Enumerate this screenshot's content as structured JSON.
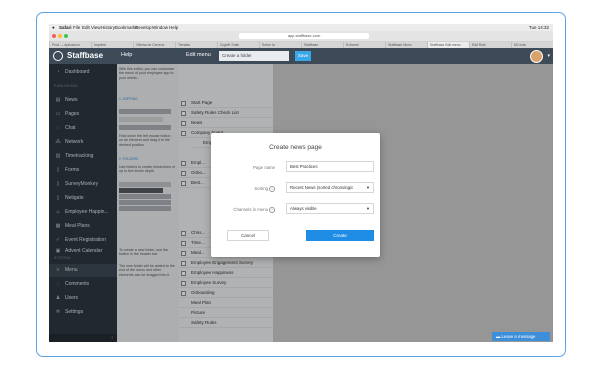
{
  "menubar": {
    "items": [
      "Safari",
      "File",
      "Edit",
      "View",
      "History",
      "Bookmarks",
      "Develop",
      "Window",
      "Help"
    ],
    "time": "Tue 14:32"
  },
  "browser": {
    "url": "app.staffbase.com",
    "tabs": [
      "Prod — Aplicacion",
      "Imprimir",
      "Oficina de Correos",
      "Tiendas",
      "Zugriff: Suite",
      "Sobre la",
      "Staffbase",
      "Extranet",
      "Staffbase Mono",
      "Staffbase Edit menu",
      "Edit Role",
      "Mi Lista"
    ]
  },
  "app": {
    "brand": "Staffbase",
    "help_title": "Help",
    "edit_menu_title": "Edit menu",
    "folder_select_placeholder": "Create a folder",
    "save_label": "Save"
  },
  "sidebar": {
    "section_publish": "PUBLISHING",
    "section_system": "SYSTEM",
    "items": [
      {
        "label": "Dashboard",
        "icon": "dashboard-icon"
      },
      {
        "label": "News",
        "icon": "news-icon"
      },
      {
        "label": "Pages",
        "icon": "pages-icon"
      },
      {
        "label": "Chat",
        "icon": "chat-icon"
      },
      {
        "label": "Network",
        "icon": "network-icon"
      },
      {
        "label": "Timetracking",
        "icon": "clock-icon"
      },
      {
        "label": "Forms",
        "icon": "forms-icon"
      },
      {
        "label": "SurveyMonkey",
        "icon": "survey-icon"
      },
      {
        "label": "Netigate",
        "icon": "netigate-icon"
      },
      {
        "label": "Employee Happin...",
        "icon": "smile-icon"
      },
      {
        "label": "Meal Plans",
        "icon": "meal-icon"
      },
      {
        "label": "Event Registration",
        "icon": "event-icon"
      },
      {
        "label": "Advent Calendar",
        "icon": "calendar-icon"
      },
      {
        "label": "Menu",
        "icon": "menu-icon"
      },
      {
        "label": "Comments",
        "icon": "comments-icon"
      },
      {
        "label": "Users",
        "icon": "users-icon"
      },
      {
        "label": "Settings",
        "icon": "settings-icon"
      }
    ]
  },
  "help": {
    "p1": "With this editor, you can customize the menu of your employee app to your needs.",
    "link_sorting": "1. SORTING",
    "p2": "Hold down the left mouse button on an element and drag it to the desired position.",
    "link_folders": "2. FOLDERS",
    "p3": "Use folders to create hierarchies of up to five levels depth.",
    "p4": "To create a new folder, use the button in the header bar.",
    "p5": "The new folder will be added to the end of the menu and other elements can be dragged into it."
  },
  "tree": {
    "items": [
      "Start Page",
      "Safety Rules Check List",
      "News",
      "Company Event",
      "Employee Event 2015",
      "Empl...",
      "Onbo...",
      "Best...",
      "Chris...",
      "Time...",
      "Meal...",
      "Employee Engagement Survey",
      "Employee Happiness",
      "Employee Survey",
      "Onboarding",
      "Meal Plan",
      "Picture",
      "Safety Rules"
    ]
  },
  "modal": {
    "title": "Create news page",
    "page_name_label": "Page name",
    "page_name_value": "Best Practices",
    "sorting_label": "Sorting",
    "sorting_value": "Recent News (sorted chronologic",
    "channel_label": "Channels in menu",
    "channel_value": "Always visible",
    "cancel_label": "Cancel",
    "create_label": "Create"
  },
  "chat": {
    "label": "Leave a message"
  }
}
